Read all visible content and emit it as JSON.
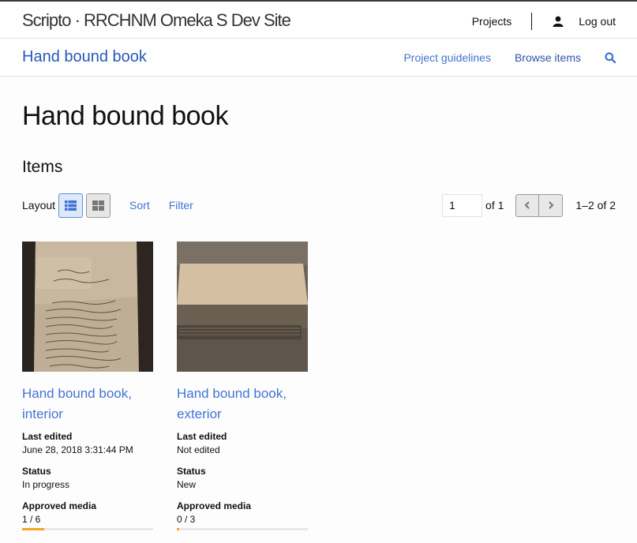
{
  "header": {
    "site_title": "Scripto · RRCHNM Omeka S Dev Site",
    "projects_label": "Projects",
    "logout_label": "Log out",
    "user_icon": "user-icon"
  },
  "project_bar": {
    "title": "Hand bound book",
    "nav": {
      "guidelines": "Project guidelines",
      "browse": "Browse items",
      "search_icon": "search-icon"
    }
  },
  "page": {
    "title": "Hand bound book",
    "section": "Items"
  },
  "toolbar": {
    "layout_label": "Layout",
    "layout_modes": [
      "list",
      "grid"
    ],
    "active_layout": "list",
    "sort_label": "Sort",
    "filter_label": "Filter"
  },
  "pagination": {
    "current_page": "1",
    "of_label": "of 1",
    "range_label": "1–2 of 2"
  },
  "colors": {
    "link": "#4273d4",
    "project_title": "#2a56b8",
    "progress_fill": "#f5a623",
    "progress_track": "#e8e8e8"
  },
  "items": [
    {
      "title": "Hand bound book, interior",
      "last_edited_label": "Last edited",
      "last_edited": "June 28, 2018 3:31:44 PM",
      "status_label": "Status",
      "status": "In progress",
      "approved_label": "Approved media",
      "approved_text": "1 / 6",
      "approved_fraction": 0.1667
    },
    {
      "title": "Hand bound book, exterior",
      "last_edited_label": "Last edited",
      "last_edited": "Not edited",
      "status_label": "Status",
      "status": "New",
      "approved_label": "Approved media",
      "approved_text": "0 / 3",
      "approved_fraction": 0
    }
  ]
}
